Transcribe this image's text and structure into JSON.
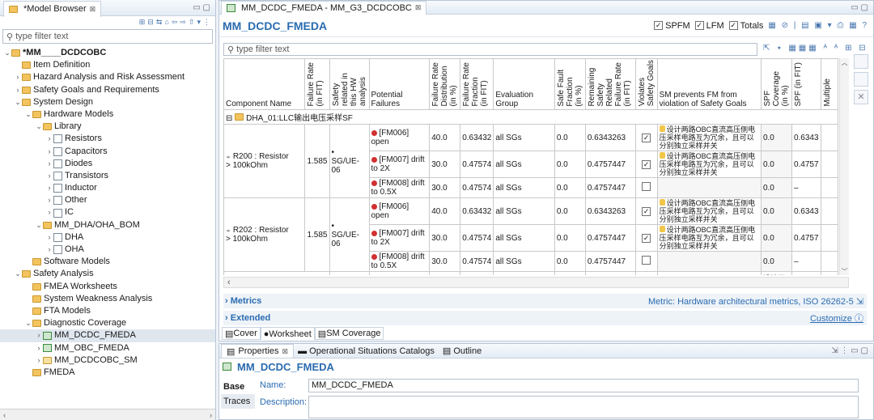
{
  "model_browser": {
    "tab_title": "*Model Browser",
    "filter_placeholder": "type filter text",
    "tree": [
      {
        "label": "*MM____DCDCOBC",
        "level": 0,
        "twisty": "v",
        "icon": "model"
      },
      {
        "label": "Item Definition",
        "level": 1,
        "twisty": "",
        "icon": "folder"
      },
      {
        "label": "Hazard Analysis and Risk Assessment",
        "level": 1,
        "twisty": ">",
        "icon": "folder"
      },
      {
        "label": "Safety Goals and Requirements",
        "level": 1,
        "twisty": ">",
        "icon": "folder"
      },
      {
        "label": "System Design",
        "level": 1,
        "twisty": "v",
        "icon": "folder"
      },
      {
        "label": "Hardware Models",
        "level": 2,
        "twisty": "v",
        "icon": "folder"
      },
      {
        "label": "Library",
        "level": 3,
        "twisty": "v",
        "icon": "folder"
      },
      {
        "label": "Resistors",
        "level": 4,
        "twisty": ">",
        "icon": "doc"
      },
      {
        "label": "Capacitors",
        "level": 4,
        "twisty": ">",
        "icon": "doc"
      },
      {
        "label": "Diodes",
        "level": 4,
        "twisty": ">",
        "icon": "doc"
      },
      {
        "label": "Transistors",
        "level": 4,
        "twisty": ">",
        "icon": "doc"
      },
      {
        "label": "Inductor",
        "level": 4,
        "twisty": ">",
        "icon": "doc"
      },
      {
        "label": "Other",
        "level": 4,
        "twisty": ">",
        "icon": "doc"
      },
      {
        "label": "IC",
        "level": 4,
        "twisty": ">",
        "icon": "doc"
      },
      {
        "label": "MM_DHA/OHA_BOM",
        "level": 3,
        "twisty": "v",
        "icon": "folder"
      },
      {
        "label": "DHA",
        "level": 4,
        "twisty": ">",
        "icon": "doc"
      },
      {
        "label": "OHA",
        "level": 4,
        "twisty": ">",
        "icon": "doc"
      },
      {
        "label": "Software Models",
        "level": 2,
        "twisty": "",
        "icon": "folder"
      },
      {
        "label": "Safety Analysis",
        "level": 1,
        "twisty": "v",
        "icon": "folder"
      },
      {
        "label": "FMEA Worksheets",
        "level": 2,
        "twisty": "",
        "icon": "folder"
      },
      {
        "label": "System Weakness Analysis",
        "level": 2,
        "twisty": "",
        "icon": "folder"
      },
      {
        "label": "FTA Models",
        "level": 2,
        "twisty": "",
        "icon": "folder"
      },
      {
        "label": "Diagnostic Coverage",
        "level": 2,
        "twisty": "v",
        "icon": "folder"
      },
      {
        "label": "MM_DCDC_FMEDA",
        "level": 3,
        "twisty": ">",
        "icon": "sheet",
        "selected": true
      },
      {
        "label": "MM_OBC_FMEDA",
        "level": 3,
        "twisty": ">",
        "icon": "sheet"
      },
      {
        "label": "MM_DCDCOBC_SM",
        "level": 3,
        "twisty": ">",
        "icon": "sm"
      },
      {
        "label": "FMEDA",
        "level": 2,
        "twisty": "",
        "icon": "folder"
      }
    ]
  },
  "editor": {
    "tab_title": "MM_DCDC_FMEDA - MM_G3_DCDCOBC",
    "form_title": "MM_DCDC_FMEDA",
    "checks": [
      {
        "label": "SPFM",
        "checked": true
      },
      {
        "label": "LFM",
        "checked": true
      },
      {
        "label": "Totals",
        "checked": true
      }
    ],
    "filter_placeholder": "type filter text",
    "columns": [
      "Component Name",
      "Failure Rate\n(in FIT)",
      "Safety\nrelated in\nthis HW\nanalysis",
      "Potential\nFailures",
      "Failure Rate\nDistribution\n(in %)",
      "Failure Rate\nFraction\n(in FIT)",
      "Evaluation\nGroup",
      "Safe Fault\nFraction\n(in %)",
      "Remaining\nSafety\nRelated\nFailure Rate\n(in FIT)",
      "Violates\nSafety Goals",
      "SM prevents FM from\nviolation of Safety Goals",
      "SPF\nCoverage\n(in %)",
      "SPF (in FIT)",
      "Multiple"
    ],
    "group_row": "DHA_01:LLC输出电压采样SF",
    "components": [
      {
        "name": "R200 : Resistor\n> 100kOhm",
        "rate": "1.585",
        "safety": "•\nSG/UE-06",
        "rows": [
          {
            "failure": "[FM006] open",
            "dist": "40.0",
            "frac": "0.63432",
            "group": "all SGs",
            "safe": "0.0",
            "remain": "0.6343263",
            "violates": true,
            "sm": "设计两路OBC直流高压侧电压采样电路互为冗余，且可以分别独立采样并关",
            "spfcov": "0.0",
            "spf": "0.6343"
          },
          {
            "failure": "[FM007] drift\nto 2X",
            "dist": "30.0",
            "frac": "0.47574",
            "group": "all SGs",
            "safe": "0.0",
            "remain": "0.4757447",
            "violates": true,
            "sm": "设计两路OBC直流高压侧电压采样电路互为冗余，且可以分别独立采样并关",
            "spfcov": "0.0",
            "spf": "0.4757"
          },
          {
            "failure": "[FM008] drift\nto 0.5X",
            "dist": "30.0",
            "frac": "0.47574",
            "group": "all SGs",
            "safe": "0.0",
            "remain": "0.4757447",
            "violates": false,
            "sm": "",
            "spfcov": "0.0",
            "spf": "–"
          }
        ]
      },
      {
        "name": "R202 : Resistor\n> 100kOhm",
        "rate": "1.585",
        "safety": "•\nSG/UE-06",
        "rows": [
          {
            "failure": "[FM006] open",
            "dist": "40.0",
            "frac": "0.63432",
            "group": "all SGs",
            "safe": "0.0",
            "remain": "0.6343263",
            "violates": true,
            "sm": "设计两路OBC直流高压侧电压采样电路互为冗余，且可以分别独立采样并关",
            "spfcov": "0.0",
            "spf": "0.6343"
          },
          {
            "failure": "[FM007] drift\nto 2X",
            "dist": "30.0",
            "frac": "0.47574",
            "group": "all SGs",
            "safe": "0.0",
            "remain": "0.4757447",
            "violates": true,
            "sm": "设计两路OBC直流高压侧电压采样电路互为冗余，且可以分别独立采样并关",
            "spfcov": "0.0",
            "spf": "0.4757"
          },
          {
            "failure": "[FM008] drift\nto 0.5X",
            "dist": "30.0",
            "frac": "0.47574",
            "group": "all SGs",
            "safe": "0.0",
            "remain": "0.4757447",
            "violates": false,
            "sm": "",
            "spfcov": "0.0",
            "spf": "–"
          }
        ]
      }
    ],
    "partial_row_sm": "设计两路OBC直流高压侧电",
    "metrics_label": "Metrics",
    "metrics_right": "Metric: Hardware architectural metrics, ISO 26262-5",
    "extended_label": "Extended",
    "customize_label": "Customize",
    "bottom_tabs": [
      "Cover",
      "Worksheet",
      "SM Coverage"
    ]
  },
  "properties": {
    "tabs": [
      "Properties",
      "Operational Situations Catalogs",
      "Outline"
    ],
    "title": "MM_DCDC_FMEDA",
    "side_tabs": [
      "Base",
      "Traces"
    ],
    "name_label": "Name:",
    "name_value": "MM_DCDC_FMEDA",
    "desc_label": "Description:"
  }
}
